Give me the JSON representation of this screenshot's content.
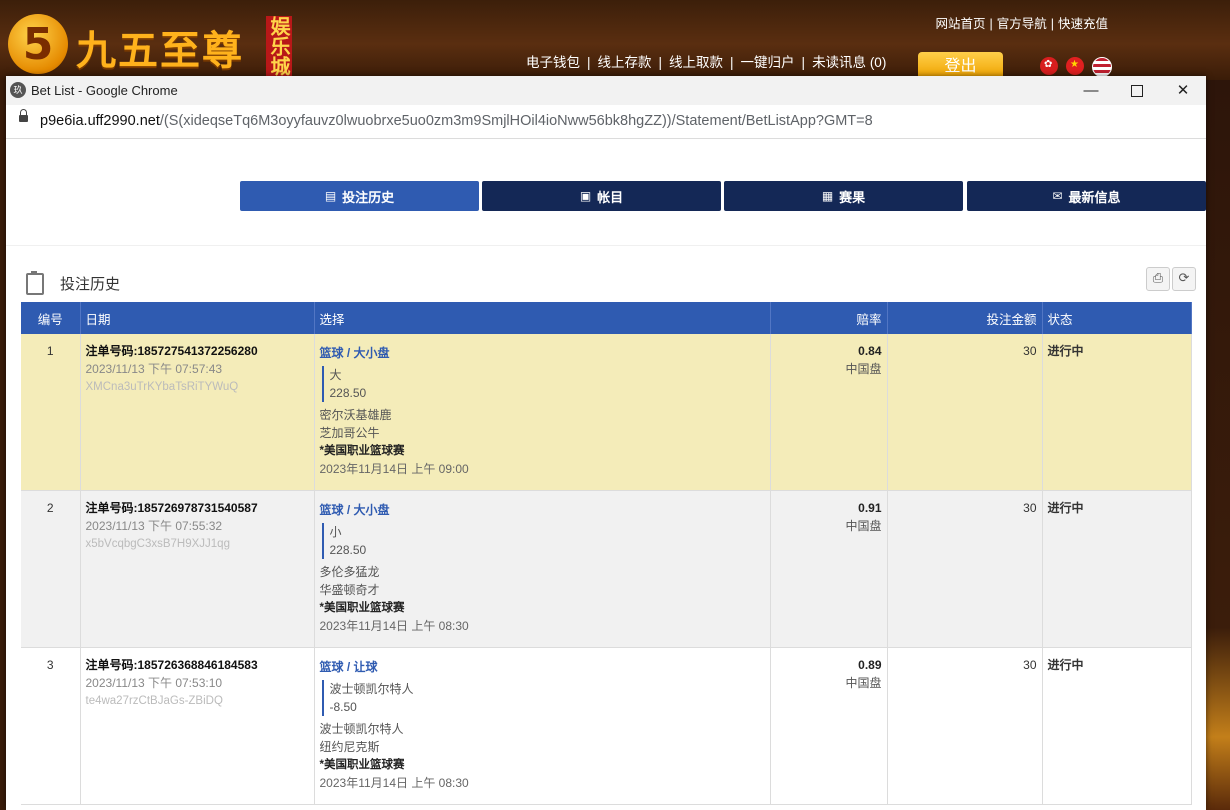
{
  "site": {
    "logo_num": "5",
    "logo_text": "九五至尊",
    "logo_badge": "娱乐城",
    "top_links": [
      "网站首页",
      "官方导航",
      "快速充值"
    ],
    "nav": [
      "电子钱包",
      "线上存款",
      "线上取款",
      "一键归户",
      "未读讯息 (0)"
    ],
    "logout": "登出"
  },
  "window": {
    "title": "Bet List - Google Chrome",
    "favicon": "玖",
    "url_host": "p9e6ia.uff2990.net",
    "url_path": "/(S(xideqseTq6M3oyyfauvz0lwuobrxe5uo0zm3m9SmjlHOil4ioNww56bk8hgZZ))/Statement/BetListApp?GMT=8"
  },
  "tabs": [
    {
      "label": "投注历史",
      "icon": "clipboard-icon",
      "glyph": "▤"
    },
    {
      "label": "帐目",
      "icon": "ledger-icon",
      "glyph": "▣"
    },
    {
      "label": "赛果",
      "icon": "results-icon",
      "glyph": "▦"
    },
    {
      "label": "最新信息",
      "icon": "mail-icon",
      "glyph": "✉"
    }
  ],
  "section": {
    "title": "投注历史"
  },
  "table": {
    "headers": {
      "no": "编号",
      "date": "日期",
      "selection": "选择",
      "odds": "赔率",
      "amount": "投注金额",
      "status": "状态"
    },
    "rows": [
      {
        "no": "1",
        "bet_no": "注单号码:185727541372256280",
        "time": "2023/11/13 下午 07:57:43",
        "code": "XMCna3uTrKYbaTsRiTYWuQ",
        "sport": "篮球 / 大小盘",
        "pick": "大",
        "line": "228.50",
        "team1": "密尔沃基雄鹿",
        "team2": "芝加哥公牛",
        "league": "*美国职业篮球赛",
        "kickoff": "2023年11月14日 上午 09:00",
        "odds": "0.84",
        "odds_type": "中国盘",
        "amount": "30",
        "status": "进行中"
      },
      {
        "no": "2",
        "bet_no": "注单号码:185726978731540587",
        "time": "2023/11/13 下午 07:55:32",
        "code": "x5bVcqbgC3xsB7H9XJJ1qg",
        "sport": "篮球 / 大小盘",
        "pick": "小",
        "line": "228.50",
        "team1": "多伦多猛龙",
        "team2": "华盛顿奇才",
        "league": "*美国职业篮球赛",
        "kickoff": "2023年11月14日 上午 08:30",
        "odds": "0.91",
        "odds_type": "中国盘",
        "amount": "30",
        "status": "进行中"
      },
      {
        "no": "3",
        "bet_no": "注单号码:185726368846184583",
        "time": "2023/11/13 下午 07:53:10",
        "code": "te4wa27rzCtBJaGs-ZBiDQ",
        "sport": "篮球 / 让球",
        "pick": "波士顿凯尔特人",
        "line": "-8.50",
        "team1": "波士顿凯尔特人",
        "team2": "纽约尼克斯",
        "league": "*美国职业篮球赛",
        "kickoff": "2023年11月14日 上午 08:30",
        "odds": "0.89",
        "odds_type": "中国盘",
        "amount": "30",
        "status": "进行中"
      }
    ]
  }
}
